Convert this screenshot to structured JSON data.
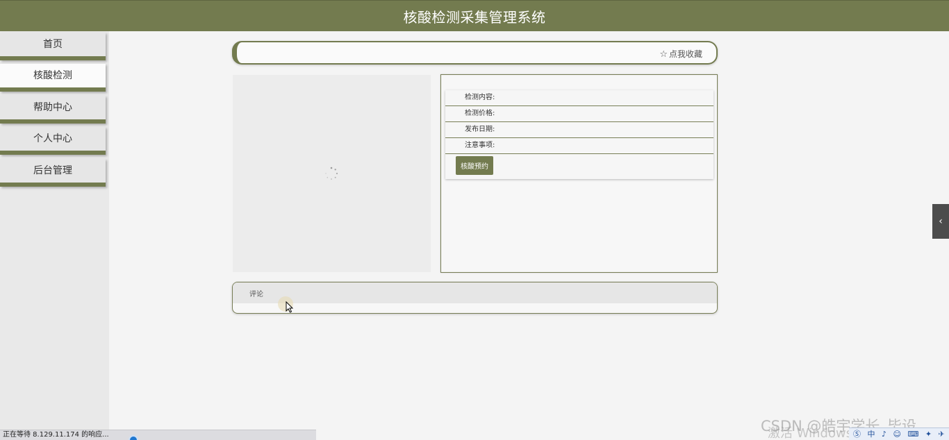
{
  "header": {
    "title": "核酸检测采集管理系统"
  },
  "sidebar": {
    "items": [
      {
        "label": "首页",
        "active": false
      },
      {
        "label": "核酸检测",
        "active": true
      },
      {
        "label": "帮助中心",
        "active": false
      },
      {
        "label": "个人中心",
        "active": false
      },
      {
        "label": "后台管理",
        "active": false
      }
    ]
  },
  "topbar": {
    "favorite_label": "点我收藏",
    "favorite_icon": "star-outline-icon"
  },
  "detail": {
    "fields": [
      {
        "label": "检测内容:"
      },
      {
        "label": "检测价格:"
      },
      {
        "label": "发布日期:"
      },
      {
        "label": "注意事项:"
      }
    ],
    "book_button": "核酸预约"
  },
  "comments": {
    "title": "评论"
  },
  "browser_status": {
    "text": "正在等待 8.129.11.174 的响应..."
  },
  "watermark": {
    "csdn": "CSDN @皓宇学长_毕设",
    "windows": "激活 Windows"
  },
  "tray": {
    "text": "Ⓢ 中 ♪ ☺ ⌨ ✦ ✈"
  },
  "colors": {
    "accent": "#737b4f",
    "background": "#f4f4f4",
    "sidebar": "#e9e9e9"
  }
}
